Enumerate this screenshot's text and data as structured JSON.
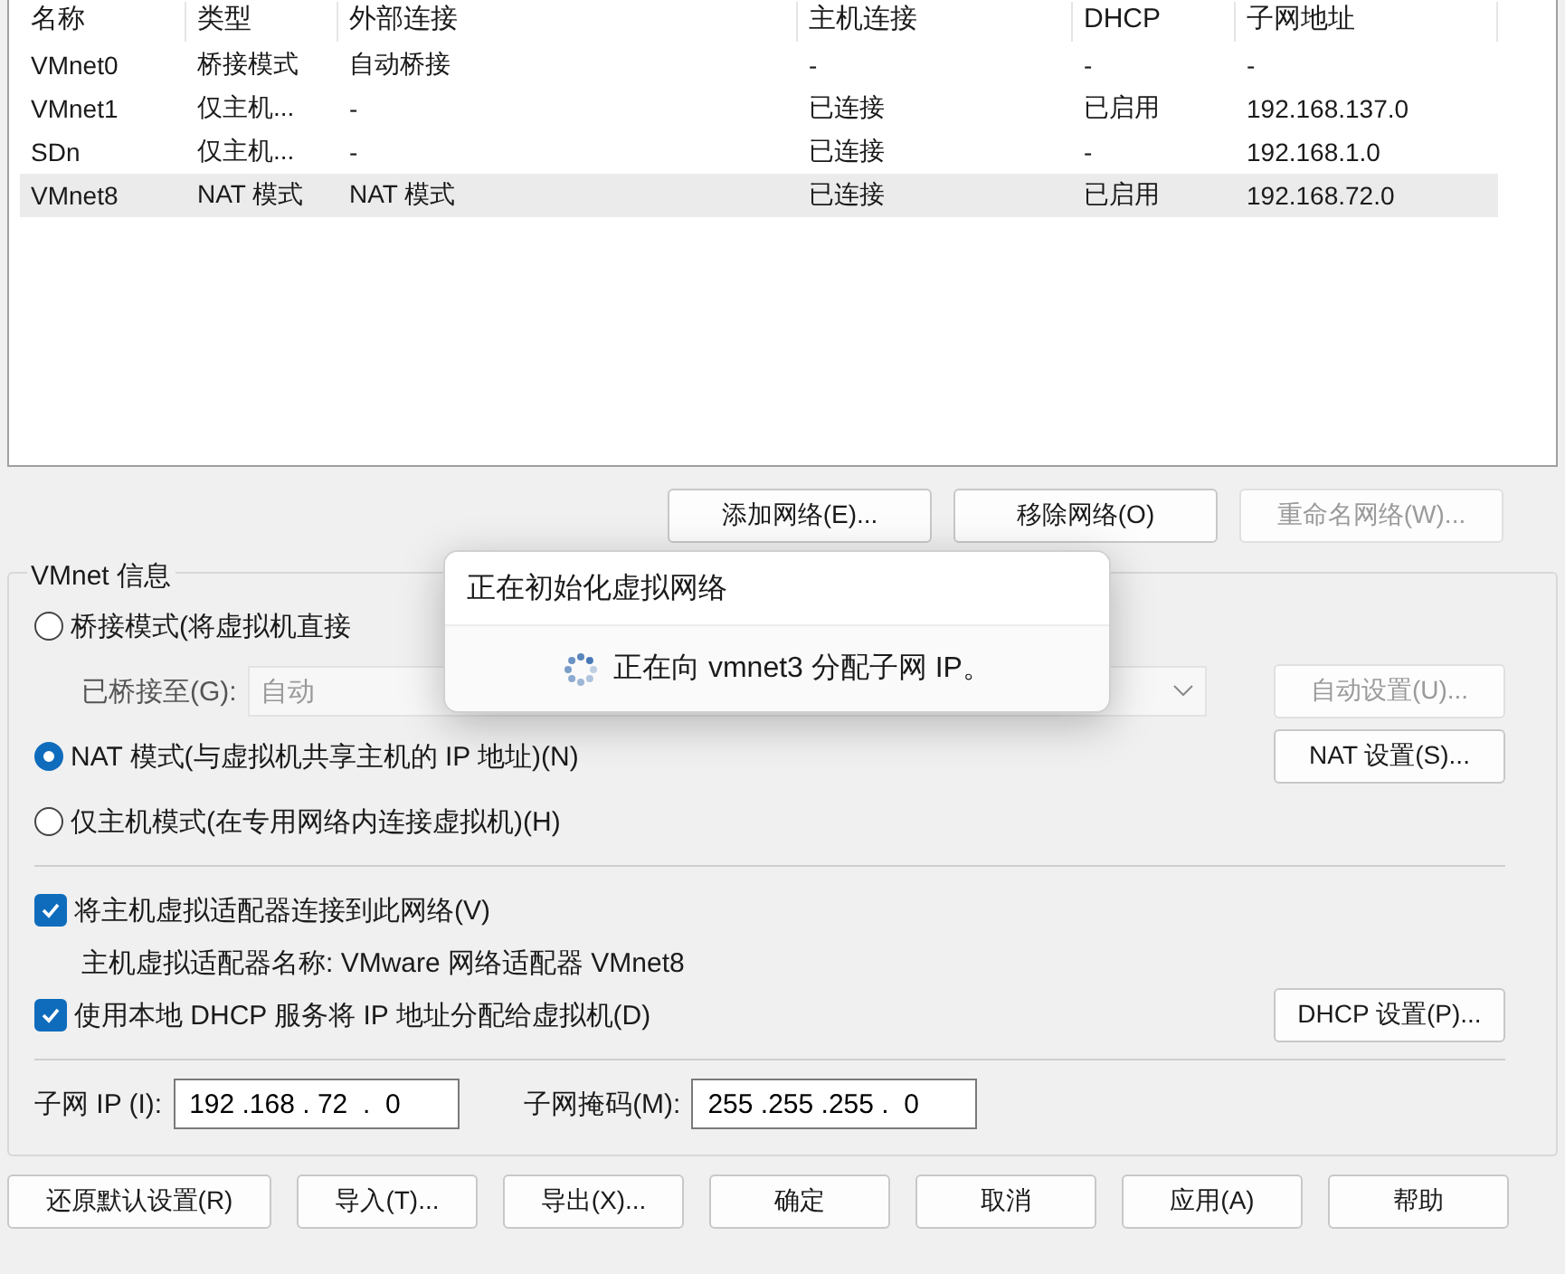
{
  "table": {
    "columns": [
      "名称",
      "类型",
      "外部连接",
      "主机连接",
      "DHCP",
      "子网地址"
    ],
    "rows": [
      {
        "cells": [
          "VMnet0",
          "桥接模式",
          "自动桥接",
          "-",
          "-",
          "-"
        ],
        "selected": false
      },
      {
        "cells": [
          "VMnet1",
          "仅主机...",
          "-",
          "已连接",
          "已启用",
          "192.168.137.0"
        ],
        "selected": false
      },
      {
        "cells": [
          "SDn",
          "仅主机...",
          "-",
          "已连接",
          "-",
          "192.168.1.0"
        ],
        "selected": false
      },
      {
        "cells": [
          "VMnet8",
          "NAT 模式",
          "NAT 模式",
          "已连接",
          "已启用",
          "192.168.72.0"
        ],
        "selected": true
      }
    ]
  },
  "network_buttons": [
    {
      "label": "添加网络(E)...",
      "disabled": false
    },
    {
      "label": "移除网络(O)",
      "disabled": false
    },
    {
      "label": "重命名网络(W)...",
      "disabled": true
    }
  ],
  "dialog": {
    "title": "正在初始化虚拟网络",
    "message": "正在向 vmnet3 分配子网 IP。"
  },
  "vmnet_info": {
    "title": "VMnet 信息",
    "modes": [
      {
        "label": "桥接模式(将虚拟机直接",
        "selected": false
      },
      {
        "label": "NAT 模式(与虚拟机共享主机的 IP 地址)(N)",
        "selected": true
      },
      {
        "label": "仅主机模式(在专用网络内连接虚拟机)(H)",
        "selected": false
      }
    ],
    "bridged_to": {
      "label": "已桥接至(G):",
      "value": "自动",
      "disabled": true
    },
    "auto_button": {
      "label": "自动设置(U)...",
      "disabled": true
    },
    "nat_button": {
      "label": "NAT 设置(S)..."
    },
    "host_adapter": {
      "label": "将主机虚拟适配器连接到此网络(V)",
      "checked": true
    },
    "adapter_name": "主机虚拟适配器名称: VMware 网络适配器 VMnet8",
    "dhcp": {
      "label": "使用本地 DHCP 服务将 IP 地址分配给虚拟机(D)",
      "checked": true
    },
    "dhcp_button": {
      "label": "DHCP 设置(P)..."
    },
    "subnet_ip": {
      "label": "子网 IP (I):",
      "value": "192 .168 . 72  .  0"
    },
    "subnet_mask": {
      "label": "子网掩码(M):",
      "value": "255 .255 .255 .  0"
    }
  },
  "footer_buttons": [
    "还原默认设置(R)",
    "导入(T)...",
    "导出(X)...",
    "确定",
    "取消",
    "应用(A)",
    "帮助"
  ]
}
